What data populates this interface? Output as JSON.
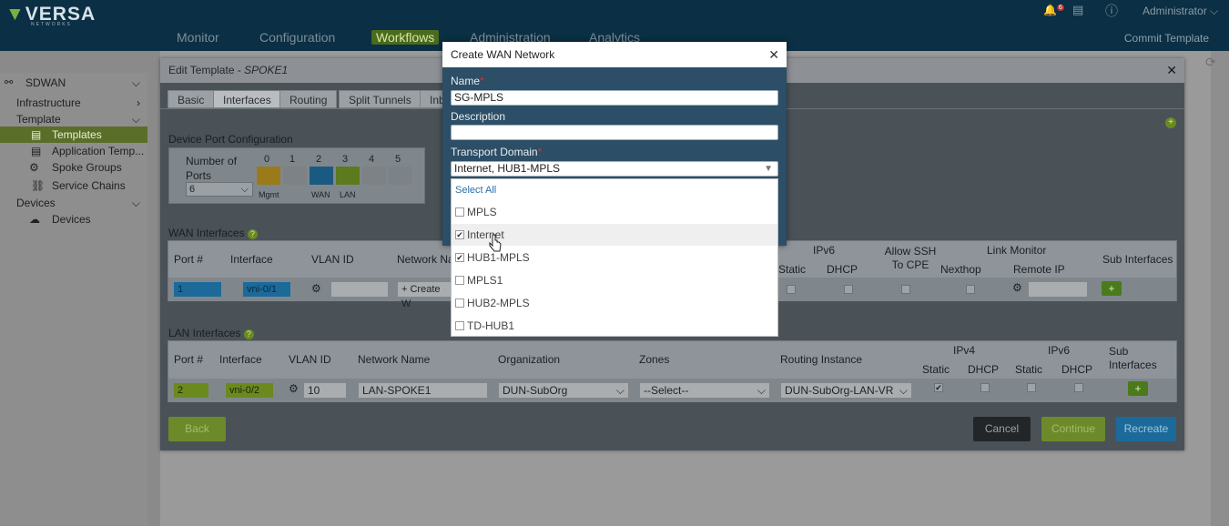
{
  "header": {
    "logo": "VERSA",
    "logo_sub": "NETWORKS",
    "nav": [
      "Monitor",
      "Configuration",
      "Workflows",
      "Administration",
      "Analytics"
    ],
    "active_nav": "Workflows",
    "user": "Administrator",
    "notification_count": "6",
    "commit_template": "Commit Template"
  },
  "sidebar": {
    "sdwan": "SDWAN",
    "infrastructure": "Infrastructure",
    "template": "Template",
    "templates": "Templates",
    "app_templates": "Application Temp...",
    "spoke_groups": "Spoke Groups",
    "service_chains": "Service Chains",
    "devices_section": "Devices",
    "devices": "Devices"
  },
  "edit_template": {
    "title_prefix": "Edit Template - ",
    "title_name": "SPOKE1",
    "tabs": [
      "Basic",
      "Interfaces",
      "Routing",
      "Split Tunnels",
      "Inb"
    ],
    "device_port_config": "Device Port Configuration",
    "number_of_ports_label": "Number of Ports",
    "number_of_ports_value": "6",
    "ports": [
      "0",
      "1",
      "2",
      "3",
      "4",
      "5"
    ],
    "port_tags": [
      "Mgmt",
      "",
      "WAN",
      "LAN",
      "",
      ""
    ],
    "wan_interfaces": "WAN Interfaces",
    "wan_headers": {
      "port": "Port #",
      "interface": "Interface",
      "vlan": "VLAN ID",
      "network": "Network Na",
      "ipv6": "IPv6",
      "static": "Static",
      "dhcp": "DHCP",
      "allow_ssh": "Allow SSH To CPE",
      "link_monitor": "Link Monitor",
      "nexthop": "Nexthop",
      "remote_ip": "Remote IP",
      "sub_interfaces": "Sub Interfaces"
    },
    "wan_row": {
      "port": "1",
      "interface": "vni-0/1",
      "vlan": "",
      "create": "+ Create W"
    },
    "lan_interfaces": "LAN Interfaces",
    "lan_headers": {
      "port": "Port #",
      "interface": "Interface",
      "vlan": "VLAN ID",
      "network": "Network Name",
      "organization": "Organization",
      "zones": "Zones",
      "routing": "Routing Instance",
      "ipv4": "IPv4",
      "ipv6": "IPv6",
      "static": "Static",
      "dhcp": "DHCP",
      "sub_interfaces": "Sub Interfaces"
    },
    "lan_row": {
      "port": "2",
      "interface": "vni-0/2",
      "vlan": "10",
      "network": "LAN-SPOKE1",
      "organization": "DUN-SubOrg",
      "zones": "--Select--",
      "routing": "DUN-SubOrg-LAN-VR"
    },
    "buttons": {
      "back": "Back",
      "cancel": "Cancel",
      "continue": "Continue",
      "recreate": "Recreate"
    }
  },
  "wan_network_modal": {
    "title": "Create WAN Network",
    "name_label": "Name",
    "name_value": "SG-MPLS",
    "description_label": "Description",
    "description_value": "",
    "transport_label": "Transport Domain",
    "transport_value": "Internet, HUB1-MPLS",
    "select_all": "Select All",
    "options": [
      {
        "label": "MPLS",
        "checked": false
      },
      {
        "label": "Internet",
        "checked": true
      },
      {
        "label": "HUB1-MPLS",
        "checked": true
      },
      {
        "label": "MPLS1",
        "checked": false
      },
      {
        "label": "HUB2-MPLS",
        "checked": false
      },
      {
        "label": "TD-HUB1",
        "checked": false
      }
    ]
  },
  "colors": {
    "topbar": "#0b2f44",
    "active_nav": "#4a6a1e",
    "modal_header": "#2c4e66",
    "recreate": "#1c6a9a",
    "continue": "#7a9a2a"
  }
}
